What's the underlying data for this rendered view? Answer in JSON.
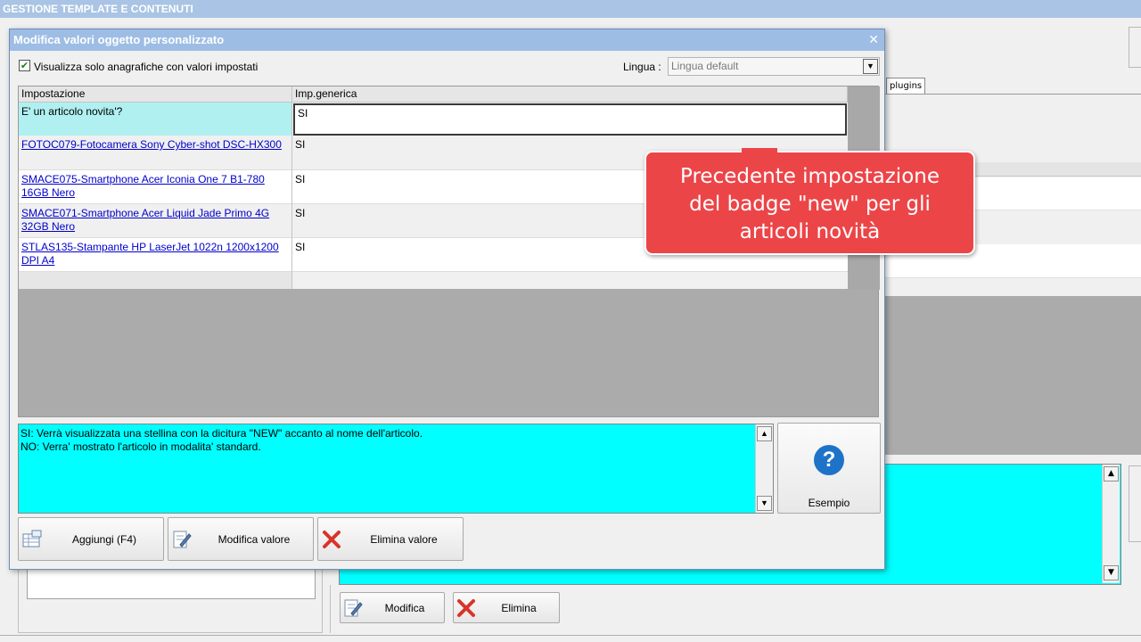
{
  "app": {
    "title": "GESTIONE TEMPLATE E CONTENUTI",
    "tab_plugins": "plugins",
    "bottom_buttons": {
      "modify": "Modifica",
      "delete": "Elimina"
    }
  },
  "dialog": {
    "title": "Modifica valori oggetto personalizzato",
    "close_icon": "close-icon",
    "filter_checkbox": {
      "label": "Visualizza solo anagrafiche con valori impostati",
      "checked": true
    },
    "language": {
      "label": "Lingua :",
      "value": "Lingua default"
    },
    "grid": {
      "columns": [
        "Impostazione",
        "Imp.generica"
      ],
      "rows": [
        {
          "setting": "E' un articolo novita'?",
          "value": "SI",
          "selected": true
        },
        {
          "setting": "FOTOC079-Fotocamera Sony Cyber-shot DSC-HX300",
          "value": "SI"
        },
        {
          "setting": "SMACE075-Smartphone Acer Iconia One 7 B1-780 16GB Nero",
          "value": "SI"
        },
        {
          "setting": "SMACE071-Smartphone Acer Liquid Jade Primo 4G 32GB Nero",
          "value": "SI"
        },
        {
          "setting": "STLAS135-Stampante HP LaserJet 1022n 1200x1200 DPI A4",
          "value": "SI"
        }
      ]
    },
    "description": {
      "line1": "SI: Verrà visualizzata una stellina con la dicitura \"NEW\" accanto al nome dell'articolo.",
      "line2": "NO: Verra' mostrato l'articolo in modalita' standard."
    },
    "example_button": "Esempio",
    "buttons": {
      "add": "Aggiungi (F4)",
      "modify": "Modifica valore",
      "delete": "Elimina valore"
    }
  },
  "callout": {
    "line1": "Precedente impostazione",
    "line2": "del badge \"new\" per gli",
    "line3": "articoli novità",
    "color": "#ec4548"
  },
  "colors": {
    "accent_title": "#9dbde5",
    "description_bg": "#00ffff",
    "link": "#0000cc"
  }
}
